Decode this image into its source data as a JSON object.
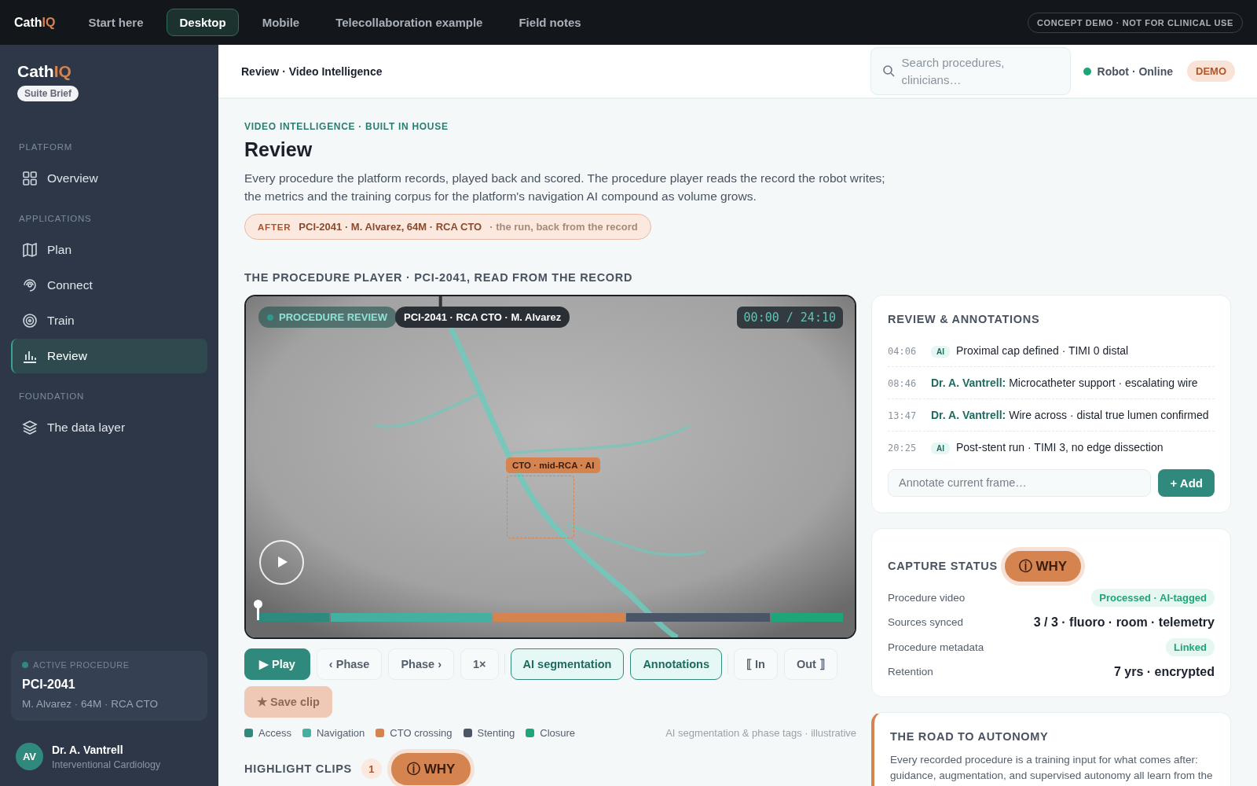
{
  "topbar": {
    "logo": {
      "main": "Cath",
      "accent": "IQ"
    },
    "tabs": [
      {
        "label": "Start here",
        "selected": false
      },
      {
        "label": "Desktop",
        "selected": true
      },
      {
        "label": "Mobile",
        "selected": false
      },
      {
        "label": "Telecollaboration example",
        "selected": false
      },
      {
        "label": "Field notes",
        "selected": false
      }
    ],
    "notice": "CONCEPT DEMO · NOT FOR CLINICAL USE"
  },
  "sidebar": {
    "logo": {
      "main": "Cath",
      "accent": "IQ"
    },
    "badge": "Suite Brief",
    "sections": [
      {
        "title": "PLATFORM",
        "items": [
          {
            "label": "Overview",
            "selected": false
          }
        ]
      },
      {
        "title": "APPLICATIONS",
        "items": [
          {
            "label": "Plan",
            "selected": false
          },
          {
            "label": "Connect",
            "selected": false
          },
          {
            "label": "Train",
            "selected": false
          },
          {
            "label": "Review",
            "selected": true
          }
        ]
      },
      {
        "title": "FOUNDATION",
        "items": [
          {
            "label": "The data layer",
            "selected": false
          }
        ]
      }
    ],
    "active_procedure": {
      "label": "ACTIVE PROCEDURE",
      "id": "PCI-2041",
      "detail": "M. Alvarez · 64M · RCA CTO"
    },
    "user": {
      "initials": "AV",
      "name": "Dr. A. Vantrell",
      "role": "Interventional Cardiology"
    }
  },
  "header": {
    "breadcrumb": "Review · Video Intelligence",
    "search": {
      "placeholder": "Search procedures, clinicians…"
    },
    "status": {
      "label": "Robot · Online",
      "online": true
    },
    "badge": "DEMO"
  },
  "page": {
    "eyebrow": "VIDEO INTELLIGENCE · BUILT IN HOUSE",
    "title": "Review",
    "description": "Every procedure the platform records, played back and scored. The procedure player reads the record the robot writes; the metrics and the training corpus for the platform's navigation AI compound as volume grows.",
    "context": {
      "tag": "AFTER",
      "record": "PCI-2041 · M. Alvarez, 64M · RCA CTO",
      "note": "· the run, back from the record"
    },
    "player_title": "THE PROCEDURE PLAYER · PCI-2041, READ FROM THE RECORD"
  },
  "player": {
    "mode_badge": "PROCEDURE REVIEW",
    "case_badge": "PCI-2041 · RCA CTO · M. Alvarez",
    "timecode": "00:00 / 24:10",
    "detection": "CTO · mid-RCA · AI",
    "playhead": {
      "level": 0
    },
    "controls": [
      {
        "label": "▶ Play",
        "kind": "primary"
      },
      {
        "label": "‹ Phase",
        "kind": "plain"
      },
      {
        "label": "Phase ›",
        "kind": "plain"
      },
      {
        "label": "1×",
        "kind": "plain"
      },
      {
        "kind": "separator"
      },
      {
        "label": "AI segmentation",
        "kind": "toggle",
        "on": true
      },
      {
        "label": "Annotations",
        "kind": "toggle",
        "on": true
      },
      {
        "kind": "separator"
      },
      {
        "label": "⟦ In",
        "kind": "plain"
      },
      {
        "label": "Out ⟧",
        "kind": "plain"
      },
      {
        "label": "★ Save clip",
        "kind": "accent",
        "disabled": true
      }
    ],
    "phases": [
      {
        "label": "Access",
        "color": "#2f8a7d"
      },
      {
        "label": "Navigation",
        "color": "#43b0a2"
      },
      {
        "label": "CTO crossing",
        "color": "#d5834f"
      },
      {
        "label": "Stenting",
        "color": "#4a5568"
      },
      {
        "label": "Closure",
        "color": "#1fa57a"
      }
    ],
    "legend_note": "AI segmentation & phase tags · illustrative"
  },
  "highlights": {
    "title": "HIGHLIGHT CLIPS",
    "count": "1",
    "why": "ⓘ WHY"
  },
  "annotations": {
    "title": "REVIEW & ANNOTATIONS",
    "items": [
      {
        "time": "04:06",
        "kind": "ai",
        "author": "AI",
        "text": "Proximal cap defined · TIMI 0 distal"
      },
      {
        "time": "08:46",
        "kind": "clinician",
        "author": "Dr. A. Vantrell:",
        "text": "Microcatheter support · escalating wire"
      },
      {
        "time": "13:47",
        "kind": "clinician",
        "author": "Dr. A. Vantrell:",
        "text": "Wire across · distal true lumen confirmed"
      },
      {
        "time": "20:25",
        "kind": "ai",
        "author": "AI",
        "text": "Post-stent run · TIMI 3, no edge dissection"
      }
    ],
    "input": {
      "placeholder": "Annotate current frame…"
    },
    "add": "+ Add"
  },
  "capture": {
    "title": "CAPTURE STATUS",
    "why": "ⓘ WHY",
    "rows": [
      {
        "label": "Procedure video",
        "value": "Processed · AI-tagged",
        "kind": "pill"
      },
      {
        "label": "Sources synced",
        "value": "3 / 3 · fluoro · room · telemetry",
        "kind": "strong"
      },
      {
        "label": "Procedure metadata",
        "value": "Linked",
        "kind": "pill"
      },
      {
        "label": "Retention",
        "value": "7 yrs · encrypted",
        "kind": "strong"
      }
    ]
  },
  "autonomy": {
    "title": "THE ROAD TO AUTONOMY",
    "text": "Every recorded procedure is a training input for what comes after: guidance, augmentation, and supervised autonomy all learn from the"
  }
}
